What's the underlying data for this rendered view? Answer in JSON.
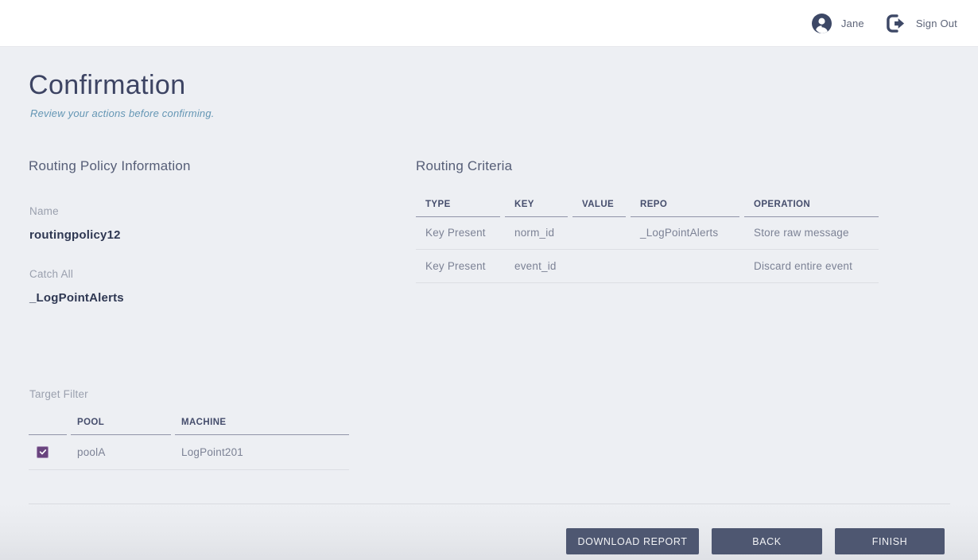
{
  "topbar": {
    "user_name": "Jane",
    "sign_out_label": "Sign Out"
  },
  "page": {
    "title": "Confirmation",
    "subtitle": "Review your actions before confirming."
  },
  "policy_info": {
    "heading": "Routing Policy Information",
    "name_label": "Name",
    "name_value": "routingpolicy12",
    "catch_all_label": "Catch All",
    "catch_all_value": "_LogPointAlerts"
  },
  "routing_criteria": {
    "heading": "Routing Criteria",
    "columns": [
      "TYPE",
      "KEY",
      "VALUE",
      "REPO",
      "OPERATION"
    ],
    "rows": [
      {
        "type": "Key Present",
        "key": "norm_id",
        "value": "",
        "repo": "_LogPointAlerts",
        "operation": "Store raw message"
      },
      {
        "type": "Key Present",
        "key": "event_id",
        "value": "",
        "repo": "",
        "operation": "Discard entire event"
      }
    ]
  },
  "target_filter": {
    "heading": "Target Filter",
    "columns": [
      "",
      "POOL",
      "MACHINE"
    ],
    "rows": [
      {
        "checked": true,
        "pool": "poolA",
        "machine": "LogPoint201"
      }
    ]
  },
  "footer": {
    "download_label": "DOWNLOAD REPORT",
    "back_label": "BACK",
    "finish_label": "FINISH"
  },
  "colors": {
    "accent_navy": "#3d4866",
    "button_bg": "#4e5771",
    "checkbox_purple": "#69447e",
    "subtitle_teal": "#6496b4",
    "content_bg": "#edeff3",
    "topbar_bg": "#ffffff"
  }
}
